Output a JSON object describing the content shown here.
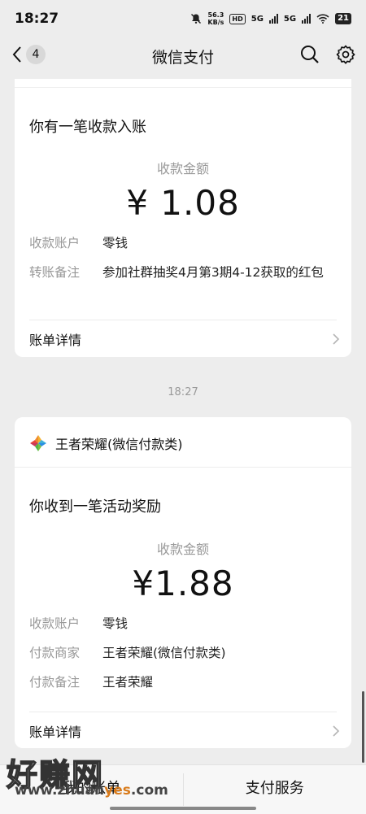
{
  "status_bar": {
    "time": "18:27",
    "net_speed_value": "56.3",
    "net_speed_unit": "KB/s",
    "hd_label": "HD",
    "sim1_label": "5G",
    "sim2_label": "5G",
    "battery": "21",
    "icons": [
      "mute-bell-icon",
      "signal-icon",
      "wifi-icon",
      "battery-icon"
    ]
  },
  "title_bar": {
    "back_count": "4",
    "title": "微信支付",
    "icons": [
      "back-chevron-icon",
      "search-icon",
      "settings-gear-icon"
    ]
  },
  "card1": {
    "notice_title": "你有一笔收款入账",
    "amount_label": "收款金额",
    "amount": "¥ 1.08",
    "rows": [
      {
        "key": "收款账户",
        "value": "零钱"
      },
      {
        "key": "转账备注",
        "value": "参加社群抽奖4月第3期4-12获取的红包"
      }
    ],
    "detail_label": "账单详情"
  },
  "time_separator": "18:27",
  "card2": {
    "merchant_name": "王者荣耀(微信付款类)",
    "notice_title": "你收到一笔活动奖励",
    "amount_label": "收款金额",
    "amount": "¥1.88",
    "rows": [
      {
        "key": "收款账户",
        "value": "零钱"
      },
      {
        "key": "付款商家",
        "value": "王者荣耀(微信付款类)"
      },
      {
        "key": "付款备注",
        "value": "王者荣耀"
      }
    ],
    "detail_label": "账单详情"
  },
  "bottom_bar": {
    "left_label": "我的账单",
    "right_label": "支付服务"
  },
  "watermark": {
    "big_text": "好赚网",
    "small_text_a": "www.zhuan",
    "small_text_b": "yes",
    "small_text_c": ".com"
  },
  "colors": {
    "page_bg": "#ededed",
    "card_bg": "#ffffff",
    "muted_text": "#999999",
    "wm_accent": "#d87a1a"
  }
}
